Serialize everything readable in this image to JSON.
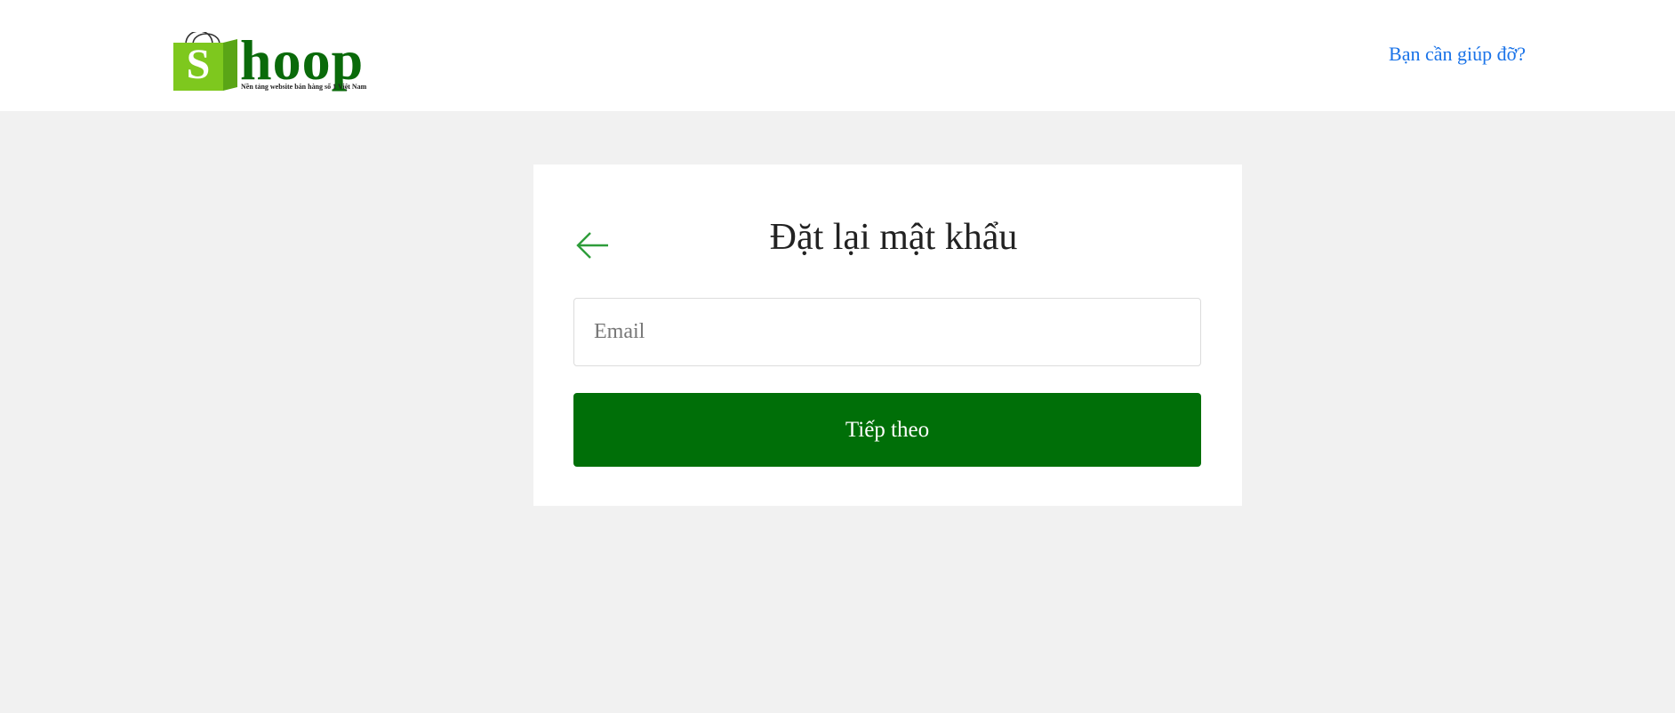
{
  "header": {
    "logo": {
      "bag_letter": "S",
      "brand_text": "hoop",
      "tagline": "Nền tảng website bán hàng số 1 Việt Nam",
      "brand_color": "#0a6a0a",
      "bag_color": "#7ec81e"
    },
    "help_link": "Bạn cần giúp đỡ?"
  },
  "card": {
    "back_icon": "arrow-left-icon",
    "title": "Đặt lại mật khẩu",
    "email": {
      "value": "",
      "placeholder": "Email"
    },
    "submit_label": "Tiếp theo"
  },
  "colors": {
    "page_background": "#f1f1f1",
    "primary_button": "#006f08",
    "link": "#1a73e8",
    "accent_arrow": "#2e9d3a"
  }
}
